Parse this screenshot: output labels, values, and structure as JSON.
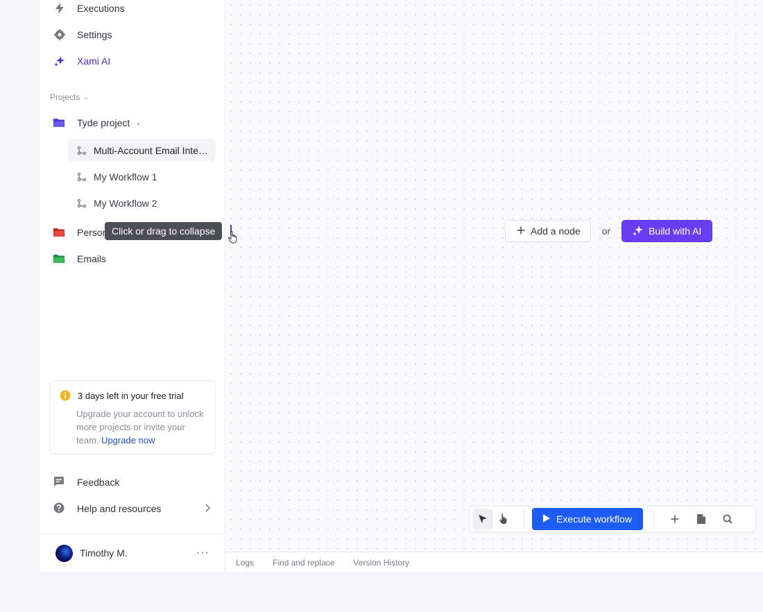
{
  "sidebar": {
    "nav": [
      {
        "label": "Executions",
        "icon": "lightning-icon"
      },
      {
        "label": "Settings",
        "icon": "gear-icon"
      },
      {
        "label": "Xami AI",
        "icon": "sparkle-icon"
      }
    ],
    "projects_label": "Projects",
    "projects": [
      {
        "label": "Tyde project",
        "color": "#4b3bd6"
      },
      {
        "label": "Personal",
        "color": "#e0342b"
      },
      {
        "label": "Emails",
        "color": "#2fa84f"
      }
    ],
    "workflows": [
      {
        "label": "Multi-Account Email Integration"
      },
      {
        "label": "My Workflow 1"
      },
      {
        "label": "My Workflow 2"
      }
    ],
    "tooltip": "Click or drag to collapse",
    "trial": {
      "title": "3 days left in your free trial",
      "body": "Upgrade your account to unlock more projects or invite your team.",
      "link": "Upgrade now"
    },
    "bottom": [
      {
        "label": "Feedback",
        "icon": "feedback-icon"
      },
      {
        "label": "Help and resources",
        "icon": "help-icon"
      }
    ],
    "user": {
      "name": "Timothy M."
    }
  },
  "canvas": {
    "add_node": "Add a node",
    "or": "or",
    "build_ai": "Build with AI",
    "execute": "Execute workflow"
  },
  "bottom_tabs": [
    "Logs",
    "Find and replace",
    "Version History"
  ],
  "colors": {
    "accent": "#6a3cf2",
    "execute": "#1c5cf5",
    "link": "#1c4fd6",
    "warning": "#f2b824"
  }
}
